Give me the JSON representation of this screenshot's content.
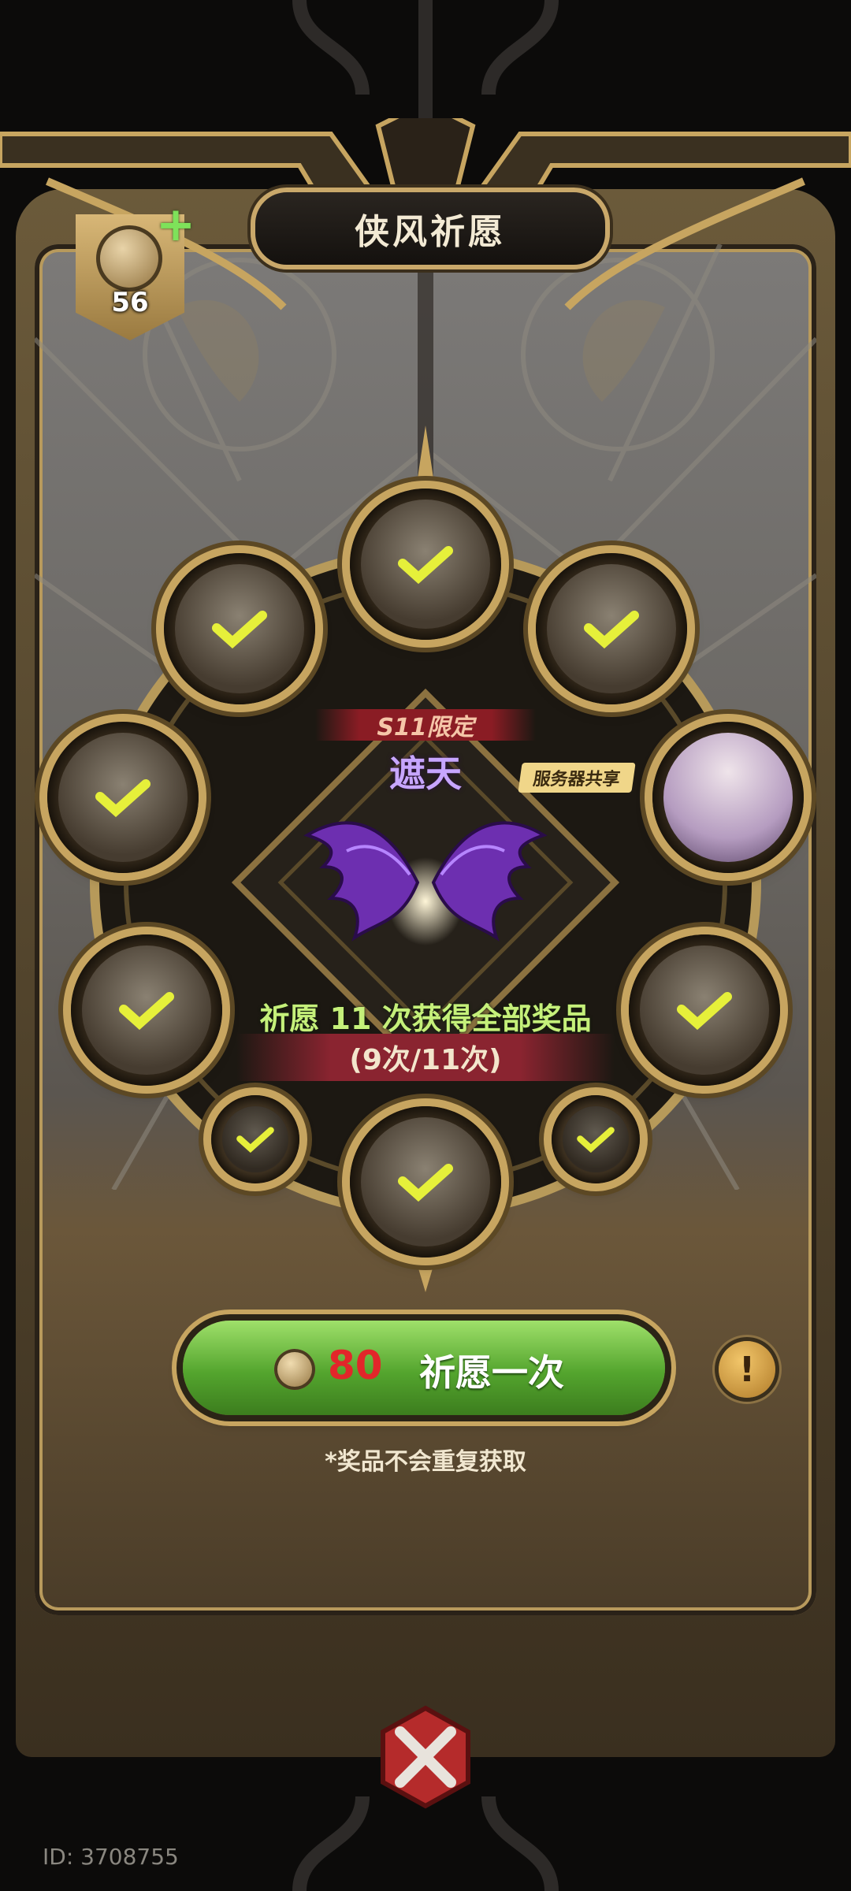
{
  "title": "侠风祈愿",
  "currency": {
    "count": "56",
    "icon": "coin-icon",
    "add_icon": "plus-icon"
  },
  "prize": {
    "season_label": "S11限定",
    "name": "遮天",
    "server_tag": "服务器共享",
    "icon": "purple-wings"
  },
  "progress": {
    "info": "祈愿 11 次获得全部奖品",
    "count": "(9次/11次)",
    "obtained": 9,
    "total": 11
  },
  "pray_button": {
    "cost": "80",
    "label": "祈愿一次",
    "coin_icon": "coin-icon"
  },
  "info_button": {
    "label": "!"
  },
  "notice": "*奖品不会重复获取",
  "user_id": "ID: 3708755",
  "slots": [
    {
      "name": "slot-top",
      "obtained": true
    },
    {
      "name": "slot-upper-left",
      "obtained": true
    },
    {
      "name": "slot-upper-right",
      "obtained": true
    },
    {
      "name": "slot-mid-left",
      "obtained": true
    },
    {
      "name": "slot-mid-right",
      "obtained": false
    },
    {
      "name": "slot-lower-left",
      "obtained": true
    },
    {
      "name": "slot-lower-right",
      "obtained": true
    },
    {
      "name": "slot-bottom",
      "obtained": true
    },
    {
      "name": "slot-small-left",
      "obtained": true
    },
    {
      "name": "slot-small-right",
      "obtained": true
    }
  ],
  "colors": {
    "accent_gold": "#c7a560",
    "button_green": "#54a52e",
    "cost_red": "#e2262a",
    "check_yellow": "#e6f03a",
    "prize_purple": "#c7a6ff"
  }
}
